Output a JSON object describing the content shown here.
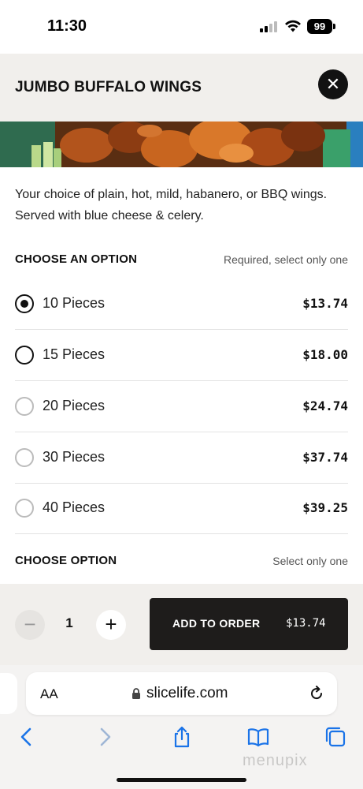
{
  "status_bar": {
    "time": "11:30",
    "battery": "99"
  },
  "header": {
    "title": "JUMBO BUFFALO WINGS",
    "close_icon": "close-icon"
  },
  "item": {
    "description": "Your choice of plain, hot, mild, habanero, or BBQ wings. Served with blue cheese & celery."
  },
  "sections": [
    {
      "title": "CHOOSE AN OPTION",
      "note": "Required, select only one",
      "options": [
        {
          "label": "10 Pieces",
          "price": "$13.74",
          "selected": true
        },
        {
          "label": "15 Pieces",
          "price": "$18.00",
          "selected": false
        },
        {
          "label": "20 Pieces",
          "price": "$24.74",
          "selected": false
        },
        {
          "label": "30 Pieces",
          "price": "$37.74",
          "selected": false
        },
        {
          "label": "40 Pieces",
          "price": "$39.25",
          "selected": false
        }
      ]
    },
    {
      "title": "CHOOSE OPTION",
      "note": "Select only one"
    }
  ],
  "order": {
    "minus_label": "−",
    "plus_label": "+",
    "quantity": "1",
    "add_label": "ADD TO ORDER",
    "add_price": "$13.74"
  },
  "browser": {
    "aa_label": "AA",
    "url": "slicelife.com",
    "icons": [
      "back-icon",
      "forward-icon",
      "share-icon",
      "bookmarks-icon",
      "tabs-icon"
    ]
  },
  "watermark": "menupix",
  "colors": {
    "accent_dark": "#1e1c1b",
    "header_bg": "#f1efec"
  }
}
